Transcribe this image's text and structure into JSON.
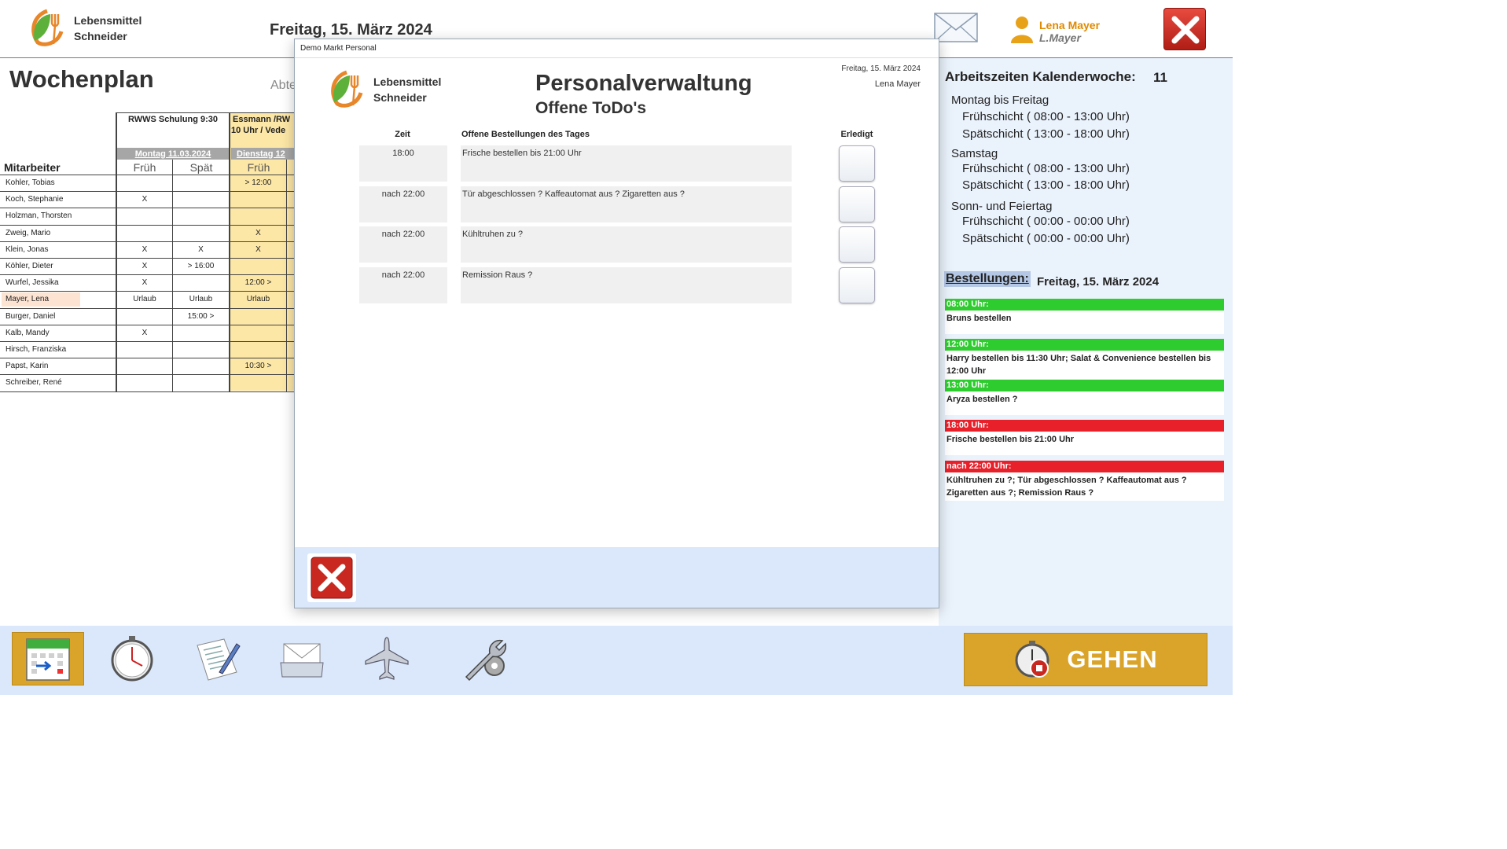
{
  "header": {
    "logo_line1": "Lebensmittel",
    "logo_line2": "Schneider",
    "date": "Freitag, 15. März 2024",
    "user_name": "Lena Mayer",
    "user_short": "L.Mayer"
  },
  "wochenplan": {
    "title": "Wochenplan",
    "abte_label": "Abte",
    "event_monday": "RWWS Schulung 9:30",
    "event_tuesday_line1": "Essmann /RW",
    "event_tuesday_line2": "10 Uhr / Vede",
    "day_monday": "Montag 11.03.2024",
    "day_tuesday": "Dienstag 12",
    "col_mitarbeiter": "Mitarbeiter",
    "col_frueh": "Früh",
    "col_spaet": "Spät",
    "rows": [
      {
        "name": "Kohler, Tobias",
        "mo_frueh": "",
        "mo_spaet": "",
        "di_frueh": "> 12:00"
      },
      {
        "name": "Koch, Stephanie",
        "mo_frueh": "X",
        "mo_spaet": "",
        "di_frueh": ""
      },
      {
        "name": "Holzman, Thorsten",
        "mo_frueh": "",
        "mo_spaet": "",
        "di_frueh": ""
      },
      {
        "name": "Zweig, Mario",
        "mo_frueh": "",
        "mo_spaet": "",
        "di_frueh": "X"
      },
      {
        "name": "Klein, Jonas",
        "mo_frueh": "X",
        "mo_spaet": "X",
        "di_frueh": "X"
      },
      {
        "name": "Köhler, Dieter",
        "mo_frueh": "X",
        "mo_spaet": "> 16:00",
        "di_frueh": ""
      },
      {
        "name": "Wurfel, Jessika",
        "mo_frueh": "X",
        "mo_spaet": "",
        "di_frueh": "12:00 >"
      },
      {
        "name": "Mayer, Lena",
        "mo_frueh": "Urlaub",
        "mo_spaet": "Urlaub",
        "di_frueh": "Urlaub"
      },
      {
        "name": "Burger, Daniel",
        "mo_frueh": "",
        "mo_spaet": "15:00 >",
        "di_frueh": ""
      },
      {
        "name": "Kalb, Mandy",
        "mo_frueh": "X",
        "mo_spaet": "",
        "di_frueh": ""
      },
      {
        "name": "Hirsch, Franziska",
        "mo_frueh": "",
        "mo_spaet": "",
        "di_frueh": ""
      },
      {
        "name": "Papst, Karin",
        "mo_frueh": "",
        "mo_spaet": "",
        "di_frueh": "10:30 >"
      },
      {
        "name": "Schreiber, René",
        "mo_frueh": "",
        "mo_spaet": "",
        "di_frueh": ""
      }
    ]
  },
  "arbeitszeiten": {
    "title": "Arbeitszeiten Kalenderwoche:",
    "kw": "11",
    "groups": [
      {
        "label": "Montag bis Freitag",
        "frueh_label": "Frühschicht",
        "frueh": "( 08:00 - 13:00 Uhr)",
        "spaet_label": "Spätschicht",
        "spaet": "( 13:00 - 18:00 Uhr)"
      },
      {
        "label": "Samstag",
        "frueh_label": "Frühschicht",
        "frueh": "( 08:00 - 13:00 Uhr)",
        "spaet_label": "Spätschicht",
        "spaet": "( 13:00 - 18:00 Uhr)"
      },
      {
        "label": "Sonn- und Feiertag",
        "frueh_label": "Frühschicht",
        "frueh": "( 00:00 - 00:00 Uhr)",
        "spaet_label": "Spätschicht",
        "spaet": "( 00:00 - 00:00 Uhr)"
      }
    ]
  },
  "bestellungen": {
    "label": "Bestellungen:",
    "date": "Freitag, 15. März 2024",
    "items": [
      {
        "time": "08:00 Uhr:",
        "color": "#2ecc2e",
        "text": "Bruns bestellen"
      },
      {
        "time": "12:00 Uhr:",
        "color": "#2ecc2e",
        "text": "Harry bestellen bis 11:30 Uhr; Salat & Convenience bestellen bis 12:00 Uhr"
      },
      {
        "time": "13:00 Uhr:",
        "color": "#2ecc2e",
        "text": "Aryza bestellen ?"
      },
      {
        "time": "18:00 Uhr:",
        "color": "#e8202a",
        "text": "Frische bestellen bis 21:00 Uhr"
      },
      {
        "time": "nach 22:00 Uhr:",
        "color": "#e8202a",
        "text": "Kühltruhen zu ?; Tür abgeschlossen ? Kaffeautomat aus ? Zigaretten aus ?; Remission Raus ?"
      }
    ]
  },
  "modal": {
    "window_title": "Demo Markt Personal",
    "date": "Freitag, 15. März 2024",
    "user": "Lena Mayer",
    "title": "Personalverwaltung",
    "subtitle": "Offene ToDo's",
    "col_zeit": "Zeit",
    "col_bestellungen": "Offene Bestellungen des Tages",
    "col_erledigt": "Erledigt",
    "todos": [
      {
        "zeit": "18:00",
        "text": "Frische bestellen bis 21:00 Uhr"
      },
      {
        "zeit": "nach 22:00",
        "text": "Tür abgeschlossen ? Kaffeautomat aus ? Zigaretten aus ?"
      },
      {
        "zeit": "nach 22:00",
        "text": "Kühltruhen zu ?"
      },
      {
        "zeit": "nach 22:00",
        "text": "Remission Raus ?"
      }
    ]
  },
  "toolbar": {
    "gehen_label": "GEHEN"
  },
  "colors": {
    "accent_yellow": "#daa42a",
    "light_blue": "#dbe8fb",
    "tuesday_fill": "#fde7a6",
    "close_red": "#c8281f"
  }
}
